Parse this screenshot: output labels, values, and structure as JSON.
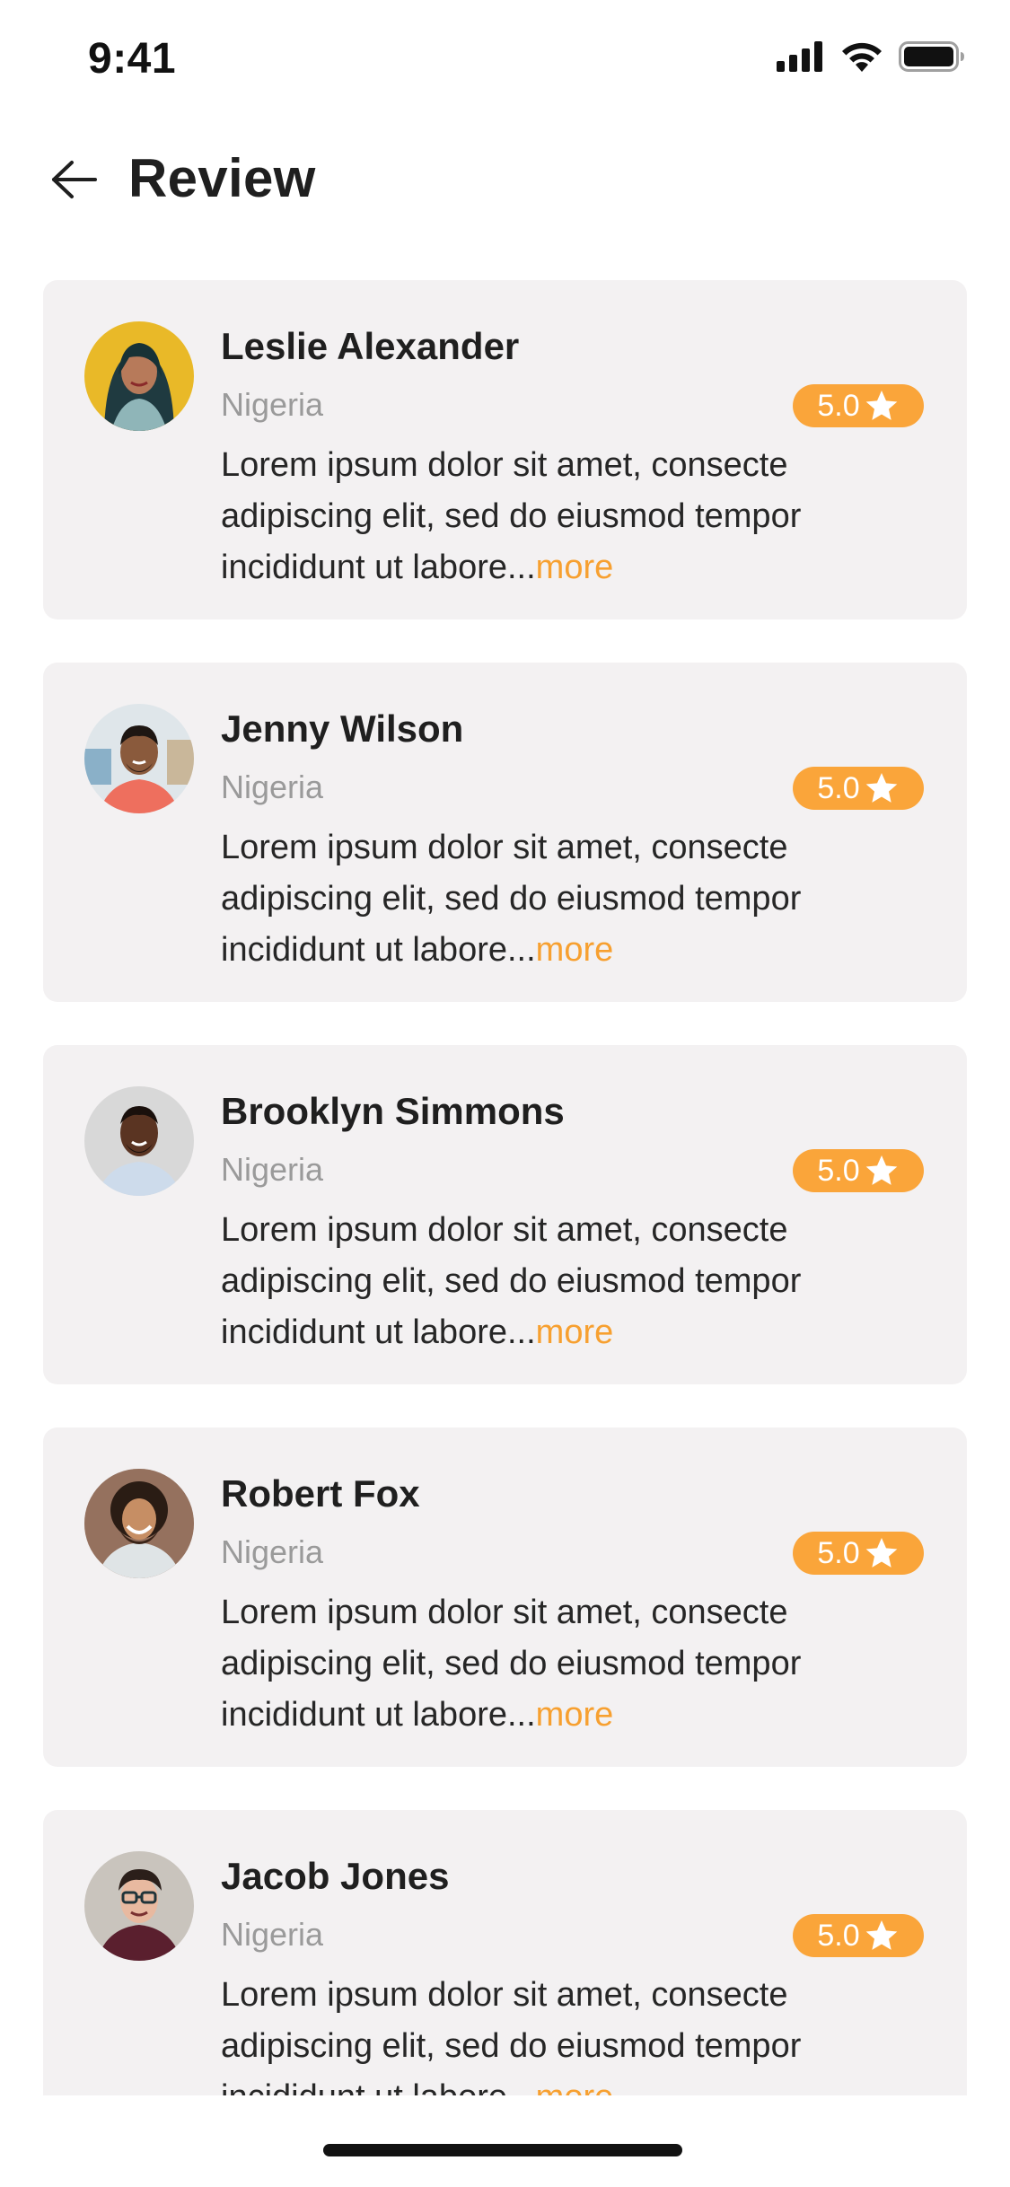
{
  "status_bar": {
    "time": "9:41",
    "icons": [
      "cellular-signal-icon",
      "wifi-icon",
      "battery-icon"
    ]
  },
  "header": {
    "back_icon": "arrow-left-icon",
    "title": "Review"
  },
  "colors": {
    "accent": "#faa53a",
    "card_background": "#f3f1f2",
    "secondary_text": "#9a9a9a"
  },
  "reviews": [
    {
      "name": "Leslie Alexander",
      "country": "Nigeria",
      "rating": "5.0",
      "text": "Lorem ipsum dolor sit amet, consecte adipiscing elit, sed do eiusmod tempor incididunt ut labore...",
      "more": "more"
    },
    {
      "name": "Jenny Wilson",
      "country": "Nigeria",
      "rating": "5.0",
      "text": "Lorem ipsum dolor sit amet, consecte adipiscing elit, sed do eiusmod tempor incididunt ut labore...",
      "more": "more"
    },
    {
      "name": "Brooklyn Simmons",
      "country": "Nigeria",
      "rating": "5.0",
      "text": "Lorem ipsum dolor sit amet, consecte adipiscing elit, sed do eiusmod tempor incididunt ut labore...",
      "more": "more"
    },
    {
      "name": "Robert Fox",
      "country": "Nigeria",
      "rating": "5.0",
      "text": "Lorem ipsum dolor sit amet, consecte adipiscing elit, sed do eiusmod tempor incididunt ut labore...",
      "more": "more"
    },
    {
      "name": "Jacob Jones",
      "country": "Nigeria",
      "rating": "5.0",
      "text": "Lorem ipsum dolor sit amet, consecte adipiscing elit, sed do eiusmod tempor incididunt ut labore...",
      "more": "more"
    }
  ]
}
